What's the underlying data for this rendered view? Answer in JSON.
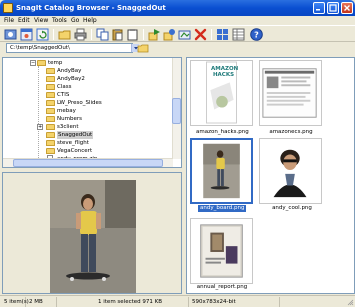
{
  "window": {
    "title": "SnagIt Catalog Browser - SnaggedOut"
  },
  "menu": {
    "items": [
      "File",
      "Edit",
      "View",
      "Tools",
      "Go",
      "Help"
    ]
  },
  "toolbar": {
    "buttons": [
      "new-capture",
      "capture-window",
      "refresh",
      "up-folder",
      "print",
      "copy",
      "paste",
      "clipboard",
      "move-to",
      "copy-to",
      "share",
      "delete",
      "thumbnails-view",
      "details-view",
      "help"
    ]
  },
  "address": {
    "value": "C:\\temp\\SnaggedOut\\"
  },
  "tree": {
    "items": [
      {
        "label": "temp",
        "level": 0
      },
      {
        "label": "AndyBay",
        "level": 1
      },
      {
        "label": "AndyBay2",
        "level": 1
      },
      {
        "label": "Class",
        "level": 1
      },
      {
        "label": "CTIS",
        "level": 1
      },
      {
        "label": "LW_Preso_Slides",
        "level": 1
      },
      {
        "label": "mebay",
        "level": 1
      },
      {
        "label": "Numbers",
        "level": 1
      },
      {
        "label": "s3client",
        "level": 1
      },
      {
        "label": "SnaggedOut",
        "level": 1
      },
      {
        "label": "steve_flight",
        "level": 1
      },
      {
        "label": "VegaConcert",
        "level": 1
      },
      {
        "label": "andy_prom.zip",
        "level": 1
      }
    ],
    "selected": "SnaggedOut"
  },
  "thumbnails": [
    {
      "caption": "amazon_hacks.png",
      "book_title": "AMAZON HACKS",
      "selected": false
    },
    {
      "caption": "amazonecs.png",
      "selected": false
    },
    {
      "caption": "andy_board.png",
      "selected": true
    },
    {
      "caption": "andy_cool.png",
      "selected": false
    },
    {
      "caption": "annual_report.png",
      "selected": false
    }
  ],
  "status": {
    "items": "5 item(s)",
    "size": "2 MB",
    "selection": "1 item selected 971 KB",
    "dimensions": "590x783x24-bit"
  },
  "colors": {
    "titlebar": "#0a4fd1",
    "selection": "#316ac5",
    "folder": "#f4d36b"
  }
}
